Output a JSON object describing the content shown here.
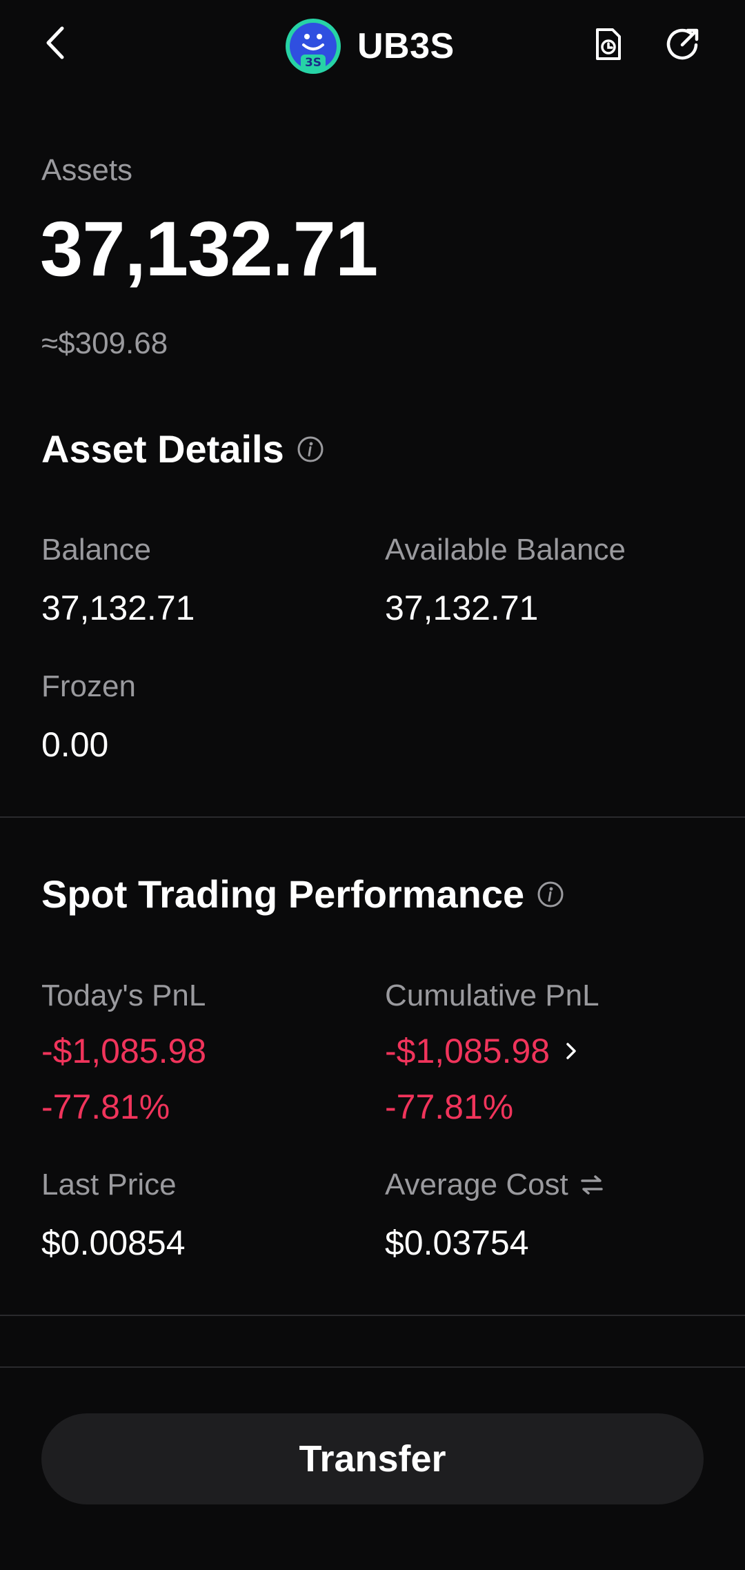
{
  "header": {
    "title": "UB3S",
    "logo_text": "3S",
    "icons": [
      "back-icon",
      "history-icon",
      "share-icon"
    ]
  },
  "assets": {
    "label": "Assets",
    "value": "37,132.71",
    "usd": "≈$309.68"
  },
  "asset_details": {
    "title": "Asset Details",
    "balance_label": "Balance",
    "balance_value": "37,132.71",
    "available_label": "Available Balance",
    "available_value": "37,132.71",
    "frozen_label": "Frozen",
    "frozen_value": "0.00"
  },
  "spot": {
    "title": "Spot Trading Performance",
    "today_label": "Today's PnL",
    "today_value": "-$1,085.98",
    "today_pct": "-77.81%",
    "cum_label": "Cumulative PnL",
    "cum_value": "-$1,085.98",
    "cum_pct": "-77.81%",
    "last_label": "Last Price",
    "last_value": "$0.00854",
    "avg_label": "Average Cost",
    "avg_value": "$0.03754"
  },
  "actions": {
    "transfer_label": "Transfer"
  },
  "colors": {
    "background": "#0a0a0b",
    "negative": "#f0345b",
    "muted_text": "#9a9a9e",
    "logo_bg": "#2f4fe0",
    "logo_ring": "#27d3a6"
  }
}
